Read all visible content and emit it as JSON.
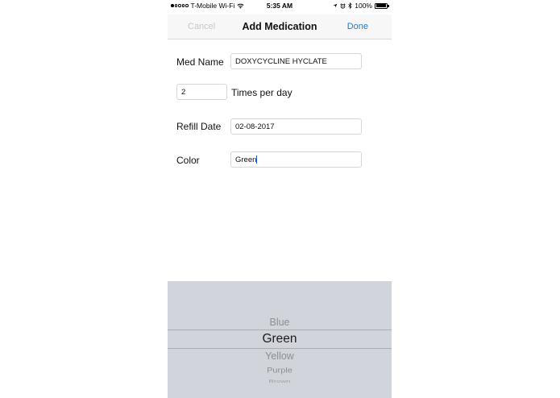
{
  "status_bar": {
    "carrier": "T-Mobile Wi-Fi",
    "time": "5:35 AM",
    "battery": "100%",
    "icons": [
      "wifi-icon",
      "location-icon",
      "alarm-icon",
      "bluetooth-icon",
      "battery-icon"
    ]
  },
  "nav": {
    "cancel_label": "Cancel",
    "title": "Add Medication",
    "done_label": "Done"
  },
  "form": {
    "med_name_label": "Med Name",
    "med_name_value": "DOXYCYCLINE HYCLATE",
    "times_value": "2",
    "times_label": "Times per day",
    "refill_label": "Refill Date",
    "refill_value": "02-08-2017",
    "color_label": "Color",
    "color_value": "Green"
  },
  "picker": {
    "options": [
      "Blue",
      "Green",
      "Yellow",
      "Purple",
      "Brown"
    ],
    "selected": "Green"
  },
  "colors": {
    "accent": "#1a7bd6",
    "cancel_disabled": "#c7c7cc",
    "picker_bg": "#d1d4da"
  }
}
